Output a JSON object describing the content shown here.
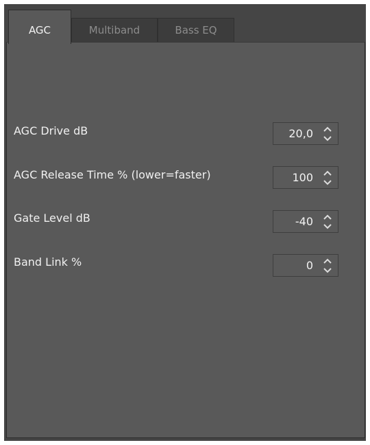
{
  "tabs": [
    {
      "label": "AGC",
      "active": true
    },
    {
      "label": "Multiband",
      "active": false
    },
    {
      "label": "Bass EQ",
      "active": false
    }
  ],
  "settings": [
    {
      "label": "AGC Drive dB",
      "value": "20,0"
    },
    {
      "label": "AGC Release Time % (lower=faster)",
      "value": "100"
    },
    {
      "label": "Gate Level dB",
      "value": "-40"
    },
    {
      "label": "Band Link %",
      "value": "0"
    }
  ],
  "colors": {
    "background": "#454545",
    "panel": "#595959",
    "text": "#f0f0f0",
    "inactive_tab_text": "#8c8c8c"
  }
}
